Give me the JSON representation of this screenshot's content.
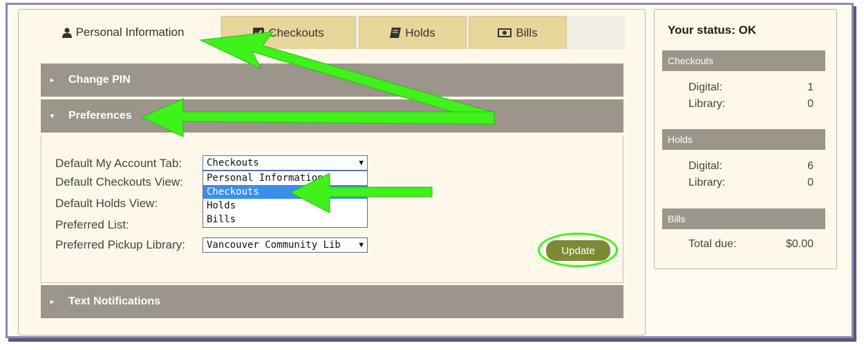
{
  "tabs": [
    {
      "label": "Personal Information",
      "icon": "user-icon",
      "active": true
    },
    {
      "label": "Checkouts",
      "icon": "checkbox-icon",
      "active": false
    },
    {
      "label": "Holds",
      "icon": "book-icon",
      "active": false
    },
    {
      "label": "Bills",
      "icon": "money-icon",
      "active": false
    }
  ],
  "sections": {
    "change_pin": "Change PIN",
    "preferences": "Preferences",
    "text_notifications": "Text Notifications"
  },
  "preferences": {
    "default_tab_label": "Default My Account Tab:",
    "default_tab_value": "Checkouts",
    "default_tab_options": [
      "Personal Information",
      "Checkouts",
      "Holds",
      "Bills"
    ],
    "default_tab_highlighted": "Checkouts",
    "checkouts_view_label": "Default Checkouts View:",
    "holds_view_label": "Default Holds View:",
    "preferred_list_label": "Preferred List:",
    "pickup_library_label": "Preferred Pickup Library:",
    "pickup_library_value": "Vancouver Community Lib",
    "update_label": "Update"
  },
  "status": {
    "title": "Your status: OK",
    "checkouts": {
      "heading": "Checkouts",
      "digital_label": "Digital:",
      "digital": "1",
      "library_label": "Library:",
      "library": "0"
    },
    "holds": {
      "heading": "Holds",
      "digital_label": "Digital:",
      "digital": "6",
      "library_label": "Library:",
      "library": "0"
    },
    "bills": {
      "heading": "Bills",
      "total_label": "Total due:",
      "total": "$0.00"
    }
  },
  "colors": {
    "tab_inactive": "#e8d59a",
    "accordion_header": "#9b958b",
    "update_button": "#7c8a35",
    "highlight": "#3b8fe8",
    "annotation_arrow": "#3ff21b"
  }
}
